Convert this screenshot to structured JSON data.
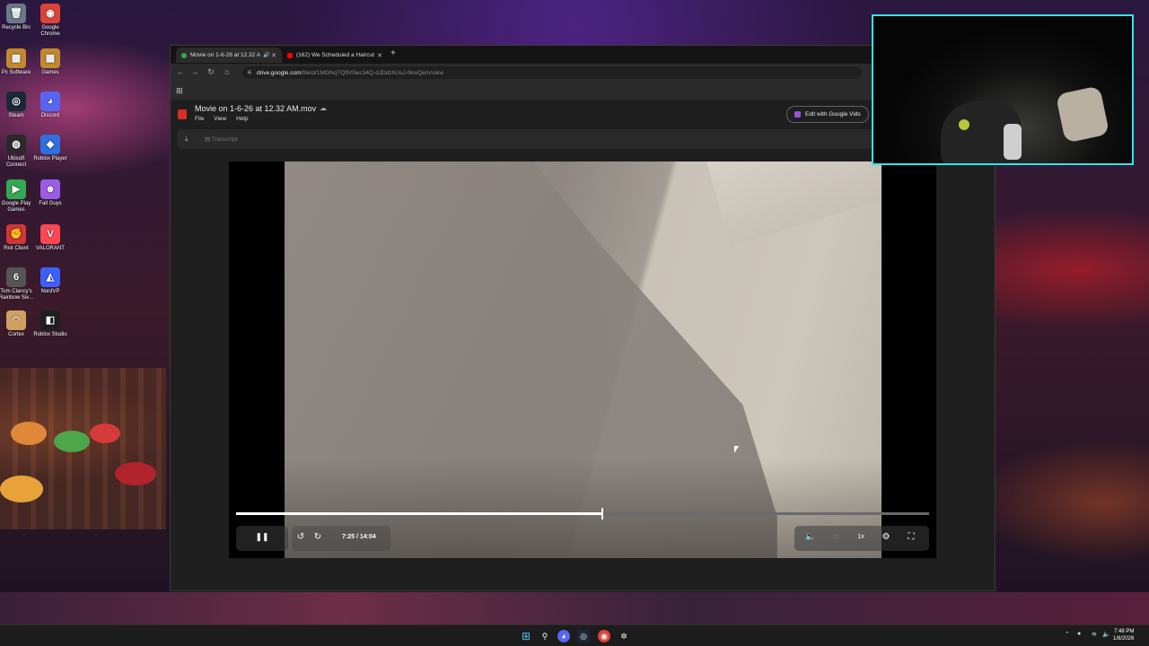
{
  "desktop": {
    "icons": [
      {
        "label": "Recycle Bin",
        "glyph": "🗑",
        "color": "#6a7a8a"
      },
      {
        "label": "Google Chrome",
        "glyph": "◉",
        "color": "#db4437"
      },
      {
        "label": "Pc Software",
        "glyph": "▦",
        "color": "#c28a2e"
      },
      {
        "label": "Games",
        "glyph": "▦",
        "color": "#c28a2e"
      },
      {
        "label": "Steam",
        "glyph": "◎",
        "color": "#1b2838"
      },
      {
        "label": "Discord",
        "glyph": "◕",
        "color": "#5865f2"
      },
      {
        "label": "Ubisoft Connect",
        "glyph": "◍",
        "color": "#2a2a2a"
      },
      {
        "label": "Roblox Player",
        "glyph": "◆",
        "color": "#2f6fde"
      },
      {
        "label": "Google Play Games",
        "glyph": "▶",
        "color": "#34a853"
      },
      {
        "label": "Fall Guys",
        "glyph": "☻",
        "color": "#9b5de5"
      },
      {
        "label": "Riot Client",
        "glyph": "✊",
        "color": "#d13639"
      },
      {
        "label": "VALORANT",
        "glyph": "V",
        "color": "#ff4655"
      },
      {
        "label": "Tom Clancy's Rainbow Six...",
        "glyph": "6",
        "color": "#555555"
      },
      {
        "label": "NordVP",
        "glyph": "◭",
        "color": "#3e5fff"
      },
      {
        "label": "Cortex",
        "glyph": "◠",
        "color": "#d0a060"
      },
      {
        "label": "Roblox Studio",
        "glyph": "◧",
        "color": "#1f1f1f"
      }
    ]
  },
  "browser": {
    "tabs": [
      {
        "title": "Movie on 1-6-26 at 12.32 A",
        "audio_icon": "🔊",
        "close": "✕",
        "favicon_color": "#34a853"
      },
      {
        "title": "(162) We Scheduled a Haircut W",
        "close": "✕",
        "favicon_color": "#ff0000"
      }
    ],
    "new_tab": "+",
    "url_host": "drive.google.com",
    "url_path": "/file/d/1MGNqTQ9V0wc34Q-dJDdzhUsJ-0kivQem/view"
  },
  "drive": {
    "file_title": "Movie on 1-6-26 at 12.32 AM.mov",
    "menu": [
      "File",
      "View",
      "Help"
    ],
    "edit_button": "Edit with Google Vids",
    "transcript_label": "Transcript"
  },
  "player": {
    "current_time": "7:25",
    "duration": "14:04",
    "time_display": "7:25  /  14:04",
    "progress_fraction": 0.528,
    "speed": "1x"
  },
  "taskbar": {
    "clock_time": "7:48 PM",
    "clock_date": "1/8/2026"
  },
  "colors": {
    "webcam_border": "#2ee6e6",
    "drive_file_red": "#d93025",
    "vids_purple": "#9b51e0"
  }
}
